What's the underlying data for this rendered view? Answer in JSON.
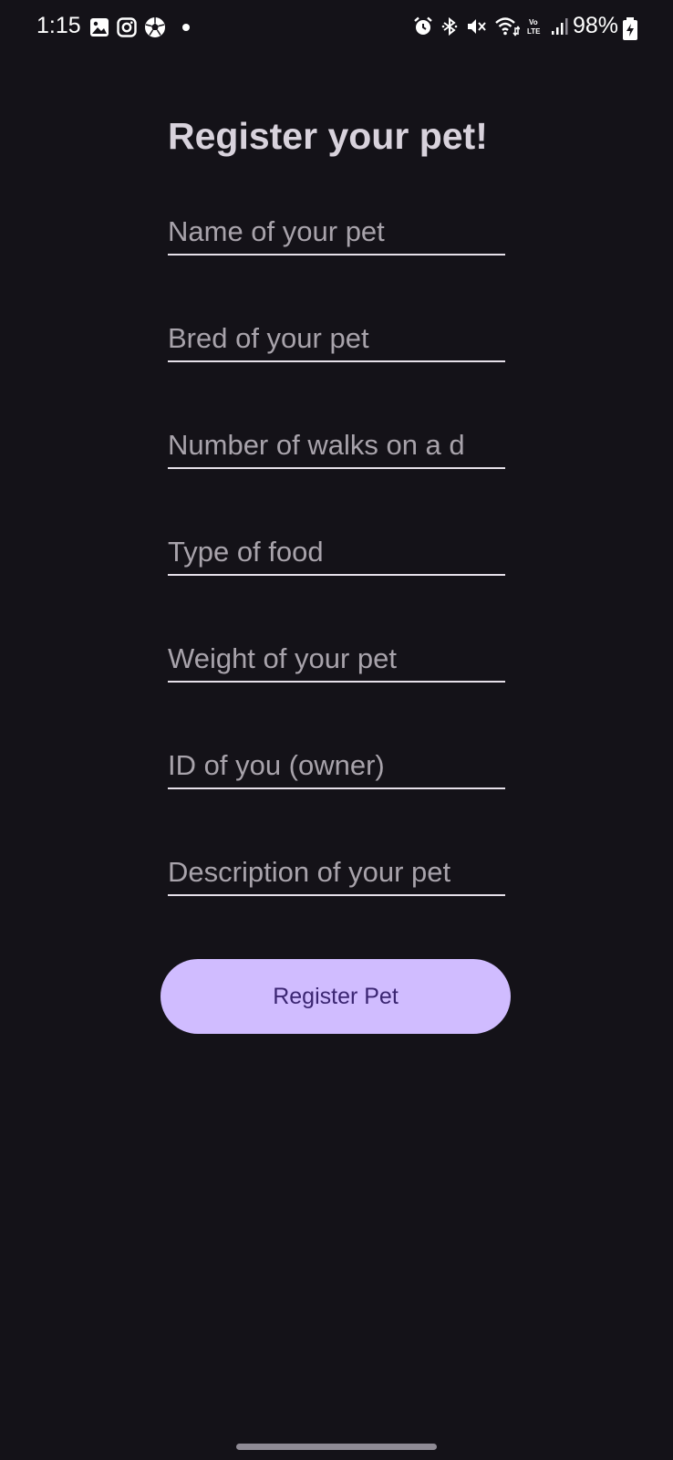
{
  "status_bar": {
    "time": "1:15",
    "battery": "98%",
    "left_icons": [
      "gallery-icon",
      "instagram-icon",
      "soccer-ball-icon",
      "dot-icon"
    ],
    "right_icons": [
      "alarm-icon",
      "bluetooth-icon",
      "mute-icon",
      "wifi-icon",
      "volte-icon",
      "signal-icon",
      "battery-charging-icon"
    ]
  },
  "form": {
    "title": "Register your pet!",
    "fields": [
      {
        "placeholder": "Name of your pet",
        "value": ""
      },
      {
        "placeholder": "Bred of your pet",
        "value": ""
      },
      {
        "placeholder": "Number of walks on a d",
        "value": ""
      },
      {
        "placeholder": "Type of food",
        "value": ""
      },
      {
        "placeholder": "Weight of your pet",
        "value": ""
      },
      {
        "placeholder": "ID of you (owner)",
        "value": ""
      },
      {
        "placeholder": "Description of your pet",
        "value": ""
      }
    ],
    "submit_label": "Register Pet"
  },
  "colors": {
    "background": "#141218",
    "button": "#d0bcff",
    "button_text": "#3b2672",
    "placeholder": "#a8a3ab",
    "underline": "#e6e0e9"
  }
}
